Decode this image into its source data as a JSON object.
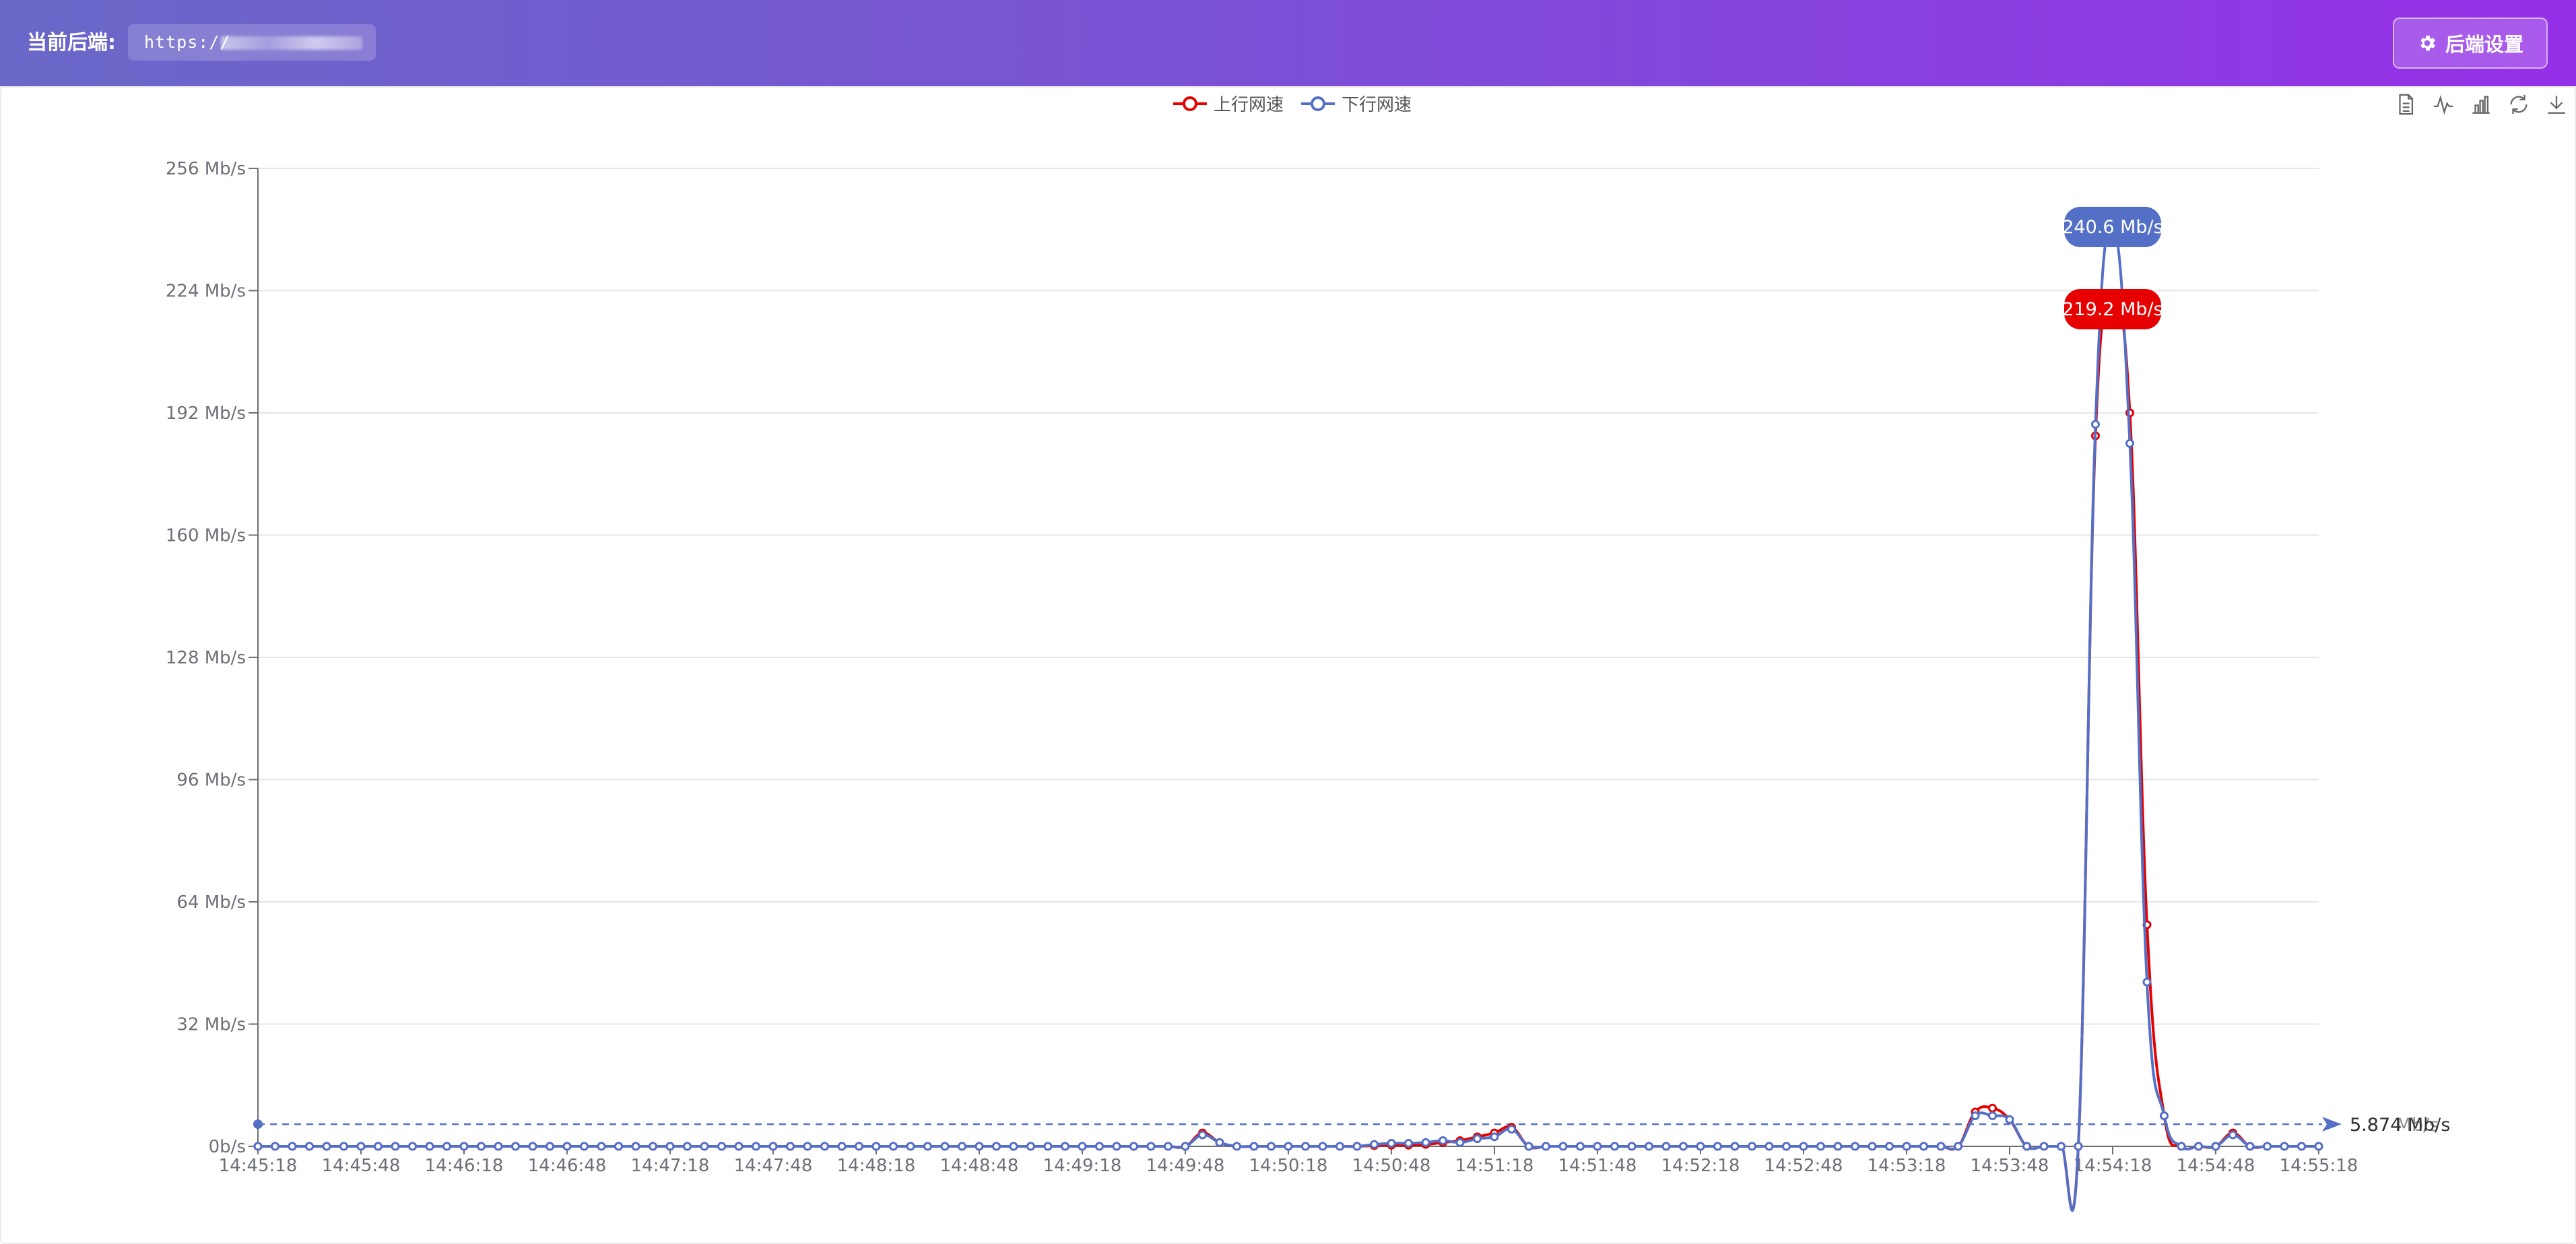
{
  "header": {
    "backend_label": "当前后端:",
    "backend_url": "https://",
    "settings_button": "后端设置"
  },
  "toolbox": {
    "icons": [
      "data-view-icon",
      "line-chart-icon",
      "bar-chart-icon",
      "restore-icon",
      "download-icon"
    ]
  },
  "colors": {
    "upload": "#e60000",
    "download": "#5470c6",
    "header_start": "#6a68c8",
    "header_end": "#9530e8"
  },
  "chart_data": {
    "type": "line",
    "legend": [
      "上行网速",
      "下行网速"
    ],
    "legend_position": "top-center",
    "y_unit": "Mb/s",
    "ylim": [
      0,
      256
    ],
    "y_ticks": [
      "0b/s",
      "32 Mb/s",
      "64 Mb/s",
      "96 Mb/s",
      "128 Mb/s",
      "160 Mb/s",
      "192 Mb/s",
      "224 Mb/s",
      "256 Mb/s"
    ],
    "x_tick_labels": [
      "14:45:18",
      "14:45:48",
      "14:46:18",
      "14:46:48",
      "14:47:18",
      "14:47:48",
      "14:48:18",
      "14:48:48",
      "14:49:18",
      "14:49:48",
      "14:50:18",
      "14:50:48",
      "14:51:18",
      "14:51:48",
      "14:52:18",
      "14:52:48",
      "14:53:18",
      "14:53:48",
      "14:54:18",
      "14:54:48",
      "14:55:18"
    ],
    "x_start": "14:45:18",
    "x_end": "14:55:18",
    "sample_interval_s": 5,
    "grid": true,
    "series": [
      {
        "name": "上行网速",
        "color": "#e60000",
        "values": [
          0,
          0,
          0,
          0,
          0,
          0,
          0,
          0,
          0,
          0,
          0,
          0,
          0,
          0,
          0,
          0,
          0,
          0,
          0,
          0,
          0,
          0,
          0,
          0,
          0,
          0,
          0,
          0,
          0,
          0,
          0,
          0,
          0,
          0,
          0,
          0,
          0,
          0,
          0,
          0,
          0,
          0,
          0,
          0,
          0,
          0,
          0,
          0,
          0,
          0,
          0,
          0,
          0,
          0,
          0,
          3.5,
          1,
          0,
          0,
          0,
          0,
          0,
          0,
          0,
          0,
          0.2,
          0.3,
          0.3,
          0.5,
          1,
          1.5,
          2.5,
          3.5,
          5,
          0,
          0,
          0,
          0,
          0,
          0,
          0,
          0,
          0,
          0,
          0,
          0,
          0,
          0,
          0,
          0,
          0,
          0,
          0,
          0,
          0,
          0,
          0,
          0,
          0,
          0,
          9,
          10,
          7,
          0,
          0,
          0,
          0,
          186,
          219.2,
          192,
          58,
          8,
          0,
          0,
          0,
          3.5,
          0,
          0,
          0,
          0,
          0
        ]
      },
      {
        "name": "下行网速",
        "color": "#5470c6",
        "values": [
          0,
          0,
          0,
          0,
          0,
          0,
          0,
          0,
          0,
          0,
          0,
          0,
          0,
          0,
          0,
          0,
          0,
          0,
          0,
          0,
          0,
          0,
          0,
          0,
          0,
          0,
          0,
          0,
          0,
          0,
          0,
          0,
          0,
          0,
          0,
          0,
          0,
          0,
          0,
          0,
          0,
          0,
          0,
          0,
          0,
          0,
          0,
          0,
          0,
          0,
          0,
          0,
          0,
          0,
          0,
          3,
          1,
          0,
          0,
          0,
          0,
          0,
          0,
          0,
          0,
          0.5,
          0.8,
          0.8,
          1,
          1.5,
          1,
          2,
          2.5,
          4.5,
          0,
          0,
          0,
          0,
          0,
          0,
          0,
          0,
          0,
          0,
          0,
          0,
          0,
          0,
          0,
          0,
          0,
          0,
          0,
          0,
          0,
          0,
          0,
          0,
          0,
          0,
          8,
          8,
          7,
          0,
          0,
          0,
          0,
          189,
          240.6,
          184,
          43,
          8,
          0,
          0,
          0,
          3,
          0,
          0,
          0,
          0,
          0
        ]
      }
    ],
    "max_labels": [
      {
        "series": "下行网速",
        "text": "240.6 Mb/s",
        "value": 240.6
      },
      {
        "series": "上行网速",
        "text": "219.2 Mb/s",
        "value": 219.2
      }
    ],
    "average_line": {
      "value": 5.8,
      "labels": [
        "5.874 Mb/s",
        "5.87 Mb/s"
      ]
    }
  }
}
